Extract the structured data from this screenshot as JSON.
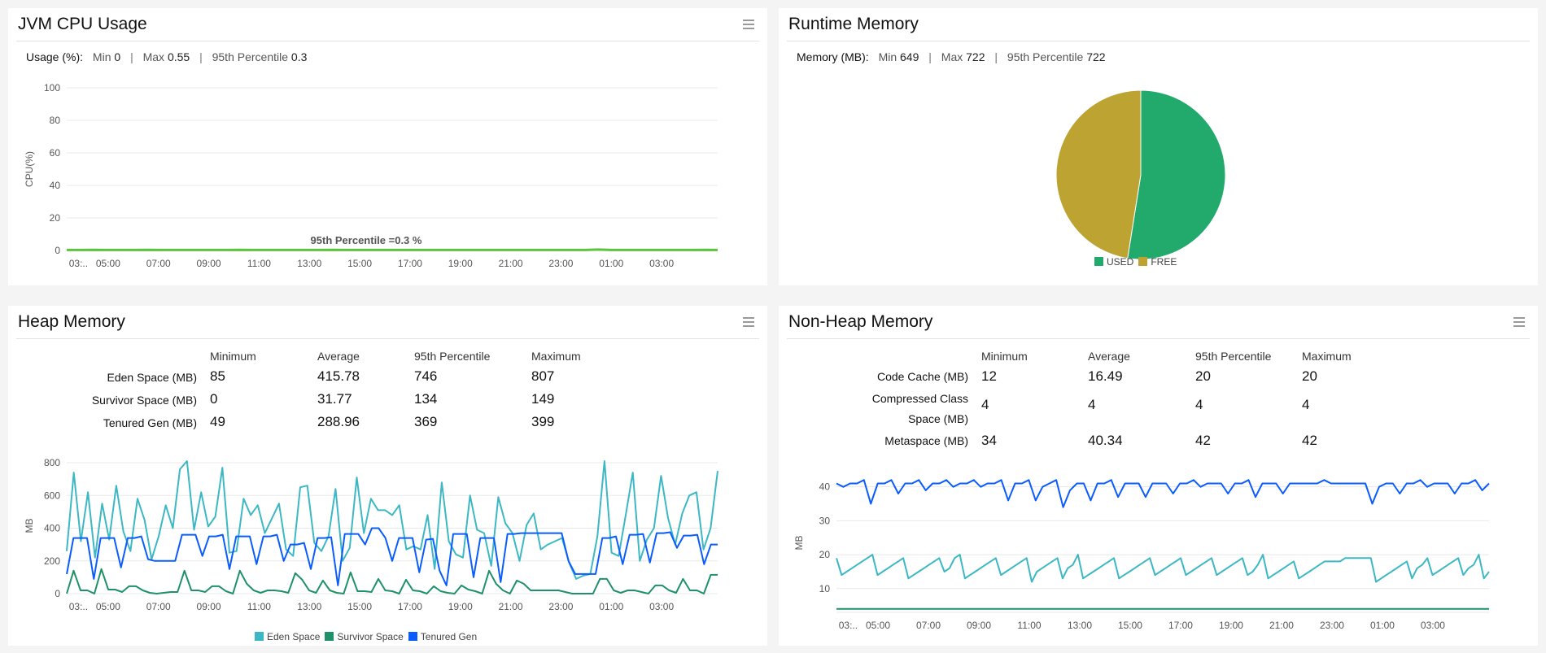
{
  "colors": {
    "cpu_line": "#5cc43c",
    "eden": "#3cb8c4",
    "survivor": "#1e9168",
    "tenured": "#0a5cff",
    "used": "#22aa6c",
    "free": "#bda332",
    "grid": "#e8e8e8"
  },
  "icons": {
    "panel_menu": "hamburger-menu-icon"
  },
  "cpu_panel": {
    "title": "JVM CPU Usage",
    "stats": {
      "lead": "Usage (%):",
      "min_label": "Min",
      "min": "0",
      "max_label": "Max",
      "max": "0.55",
      "p95_label": "95th Percentile",
      "p95": "0.3",
      "sep": "|"
    }
  },
  "memory_panel": {
    "title": "Runtime Memory",
    "stats": {
      "lead": "Memory (MB):",
      "min_label": "Min",
      "min": "649",
      "max_label": "Max",
      "max": "722",
      "p95_label": "95th Percentile",
      "p95": "722",
      "sep": "|"
    }
  },
  "heap_panel": {
    "title": "Heap Memory",
    "columns": [
      "Minimum",
      "Average",
      "95th Percentile",
      "Maximum"
    ],
    "rows": [
      {
        "label": "Eden Space (MB)",
        "values": [
          "85",
          "415.78",
          "746",
          "807"
        ]
      },
      {
        "label": "Survivor Space (MB)",
        "values": [
          "0",
          "31.77",
          "134",
          "149"
        ]
      },
      {
        "label": "Tenured Gen (MB)",
        "values": [
          "49",
          "288.96",
          "369",
          "399"
        ]
      }
    ]
  },
  "nonheap_panel": {
    "title": "Non-Heap Memory",
    "columns": [
      "Minimum",
      "Average",
      "95th Percentile",
      "Maximum"
    ],
    "rows": [
      {
        "label": "Code Cache (MB)",
        "values": [
          "12",
          "16.49",
          "20",
          "20"
        ]
      },
      {
        "label": "Compressed Class Space (MB)",
        "values": [
          "4",
          "4",
          "4",
          "4"
        ]
      },
      {
        "label": "Metaspace (MB)",
        "values": [
          "34",
          "40.34",
          "42",
          "42"
        ]
      }
    ]
  },
  "chart_data": [
    {
      "id": "cpu",
      "type": "line",
      "ylabel": "CPU(%)",
      "ylim": [
        0,
        100
      ],
      "yticks": [
        "0",
        "20",
        "40",
        "60",
        "80",
        "100"
      ],
      "xticks": [
        "03:..",
        "05:00",
        "07:00",
        "09:00",
        "11:00",
        "13:00",
        "15:00",
        "17:00",
        "19:00",
        "21:00",
        "23:00",
        "01:00",
        "03:00"
      ],
      "grid": true,
      "annotation": "95th Percentile =0.3 %",
      "series": [
        {
          "values": [
            0.3,
            0.3,
            0.4,
            0.3,
            0.3,
            0.3,
            0.4,
            0.3,
            0.3,
            0.3,
            0.3,
            0.3,
            0.3,
            0.4,
            0.3,
            0.3,
            0.3,
            0.3,
            0.3,
            0.3,
            0.4,
            0.3,
            0.3,
            0.3,
            0.3,
            0.3,
            0.3,
            0.3,
            0.3,
            0.3,
            0.3,
            0.3,
            0.3,
            0.3,
            0.3,
            0.3,
            0.3,
            0.3,
            0.3,
            0.3,
            0.55,
            0.3,
            0.3,
            0.3,
            0.3,
            0.3,
            0.3,
            0.3,
            0.4,
            0.3
          ]
        }
      ]
    },
    {
      "id": "memory",
      "type": "pie",
      "slices": [
        {
          "name": "USED",
          "value": 52.5
        },
        {
          "name": "FREE",
          "value": 47.5
        }
      ],
      "legend": "bottom"
    },
    {
      "id": "heap",
      "type": "line",
      "ylabel": "MB",
      "ylim": [
        0,
        830
      ],
      "yticks": [
        "0",
        "200",
        "400",
        "600",
        "800"
      ],
      "xticks": [
        "03:..",
        "05:00",
        "07:00",
        "09:00",
        "11:00",
        "13:00",
        "15:00",
        "17:00",
        "19:00",
        "21:00",
        "23:00",
        "01:00",
        "03:00"
      ],
      "grid": true,
      "legend": "bottom",
      "series": [
        {
          "name": "Eden Space",
          "values": [
            260,
            740,
            320,
            620,
            220,
            550,
            330,
            660,
            380,
            260,
            580,
            450,
            210,
            350,
            540,
            400,
            760,
            810,
            390,
            620,
            410,
            470,
            770,
            250,
            260,
            580,
            480,
            540,
            370,
            460,
            550,
            270,
            230,
            650,
            660,
            310,
            260,
            350,
            640,
            200,
            280,
            710,
            370,
            580,
            510,
            510,
            480,
            540,
            270,
            290,
            270,
            480,
            150,
            680,
            320,
            240,
            220,
            600,
            390,
            370,
            170,
            590,
            430,
            370,
            200,
            420,
            490,
            270,
            300,
            320,
            340,
            190,
            90,
            110,
            120,
            350,
            810,
            250,
            230,
            480,
            740,
            200,
            330,
            400,
            720,
            460,
            300,
            490,
            600,
            620,
            270,
            400,
            750
          ]
        },
        {
          "name": "Survivor Space",
          "values": [
            0,
            140,
            20,
            20,
            0,
            150,
            25,
            25,
            10,
            45,
            45,
            20,
            5,
            0,
            5,
            10,
            10,
            140,
            20,
            20,
            10,
            45,
            45,
            15,
            0,
            140,
            60,
            20,
            5,
            20,
            20,
            15,
            5,
            125,
            85,
            20,
            5,
            80,
            20,
            5,
            0,
            130,
            15,
            15,
            10,
            90,
            20,
            15,
            0,
            85,
            20,
            15,
            0,
            45,
            15,
            5,
            0,
            50,
            25,
            15,
            0,
            140,
            60,
            20,
            0,
            80,
            60,
            20,
            20,
            20,
            20,
            20,
            10,
            0,
            0,
            0,
            0,
            90,
            90,
            20,
            5,
            20,
            20,
            10,
            0,
            50,
            50,
            20,
            5,
            90,
            20,
            20,
            0,
            115,
            115
          ]
        },
        {
          "name": "Tenured Gen",
          "values": [
            120,
            340,
            340,
            340,
            90,
            340,
            340,
            340,
            160,
            340,
            340,
            350,
            210,
            200,
            200,
            200,
            200,
            360,
            360,
            360,
            230,
            350,
            350,
            360,
            150,
            350,
            350,
            350,
            180,
            350,
            350,
            360,
            200,
            300,
            300,
            310,
            150,
            340,
            340,
            345,
            50,
            365,
            365,
            365,
            300,
            400,
            400,
            340,
            200,
            340,
            340,
            340,
            130,
            330,
            335,
            140,
            50,
            365,
            365,
            365,
            100,
            340,
            340,
            340,
            70,
            365,
            365,
            370,
            370,
            370,
            370,
            370,
            370,
            370,
            200,
            120,
            120,
            120,
            120,
            340,
            340,
            350,
            180,
            360,
            360,
            365,
            190,
            370,
            370,
            375,
            280,
            355,
            355,
            360,
            180,
            300,
            300
          ]
        }
      ]
    },
    {
      "id": "nonheap",
      "type": "line",
      "ylabel": "MB",
      "ylim": [
        3,
        44
      ],
      "yticks": [
        "10",
        "20",
        "30",
        "40"
      ],
      "xticks": [
        "03:..",
        "05:00",
        "07:00",
        "09:00",
        "11:00",
        "13:00",
        "15:00",
        "17:00",
        "19:00",
        "21:00",
        "23:00",
        "01:00",
        "03:00"
      ],
      "grid": true,
      "series": [
        {
          "values": [
            41,
            40,
            41,
            41,
            42,
            35,
            41,
            41,
            42,
            38,
            41,
            41,
            42,
            39,
            41,
            41,
            42,
            40,
            41,
            41,
            42,
            40,
            41,
            41,
            42,
            36,
            41,
            41,
            42,
            36,
            40,
            41,
            42,
            34,
            39,
            41,
            41,
            36,
            41,
            41,
            42,
            37,
            41,
            41,
            41,
            37,
            41,
            41,
            41,
            38,
            41,
            41,
            42,
            40,
            41,
            41,
            41,
            38,
            41,
            41,
            42,
            37,
            41,
            41,
            41,
            38,
            41,
            41,
            41,
            41,
            41,
            42,
            41,
            41,
            41,
            41,
            41,
            41,
            35,
            40,
            41,
            41,
            38,
            41,
            41,
            42,
            40,
            41,
            41,
            41,
            38,
            41,
            41,
            42,
            39,
            41
          ]
        },
        {
          "values": [
            19,
            14,
            15,
            16,
            17,
            18,
            19,
            20,
            14,
            15,
            16,
            17,
            18,
            19,
            13,
            14,
            15,
            16,
            17,
            18,
            19,
            15,
            16,
            19,
            20,
            13,
            14,
            15,
            16,
            17,
            18,
            19,
            14,
            15,
            16,
            17,
            18,
            19,
            12,
            15,
            16,
            17,
            18,
            19,
            13,
            16,
            17,
            20,
            13,
            14,
            15,
            16,
            17,
            18,
            19,
            13,
            14,
            15,
            16,
            17,
            18,
            19,
            14,
            15,
            16,
            17,
            18,
            19,
            14,
            15,
            16,
            17,
            18,
            19,
            14,
            15,
            16,
            17,
            18,
            19,
            14,
            15,
            17,
            20,
            13,
            14,
            15,
            16,
            17,
            18,
            13,
            14,
            15,
            16,
            17,
            18,
            18,
            18,
            18,
            19,
            19,
            19,
            19,
            19,
            19,
            12,
            13,
            14,
            15,
            16,
            17,
            18,
            13,
            16,
            17,
            19,
            14,
            15,
            16,
            17,
            18,
            19,
            14,
            16,
            17,
            20,
            13,
            15
          ]
        },
        {
          "values": [
            4,
            4,
            4,
            4,
            4,
            4,
            4,
            4,
            4,
            4
          ]
        }
      ]
    }
  ]
}
